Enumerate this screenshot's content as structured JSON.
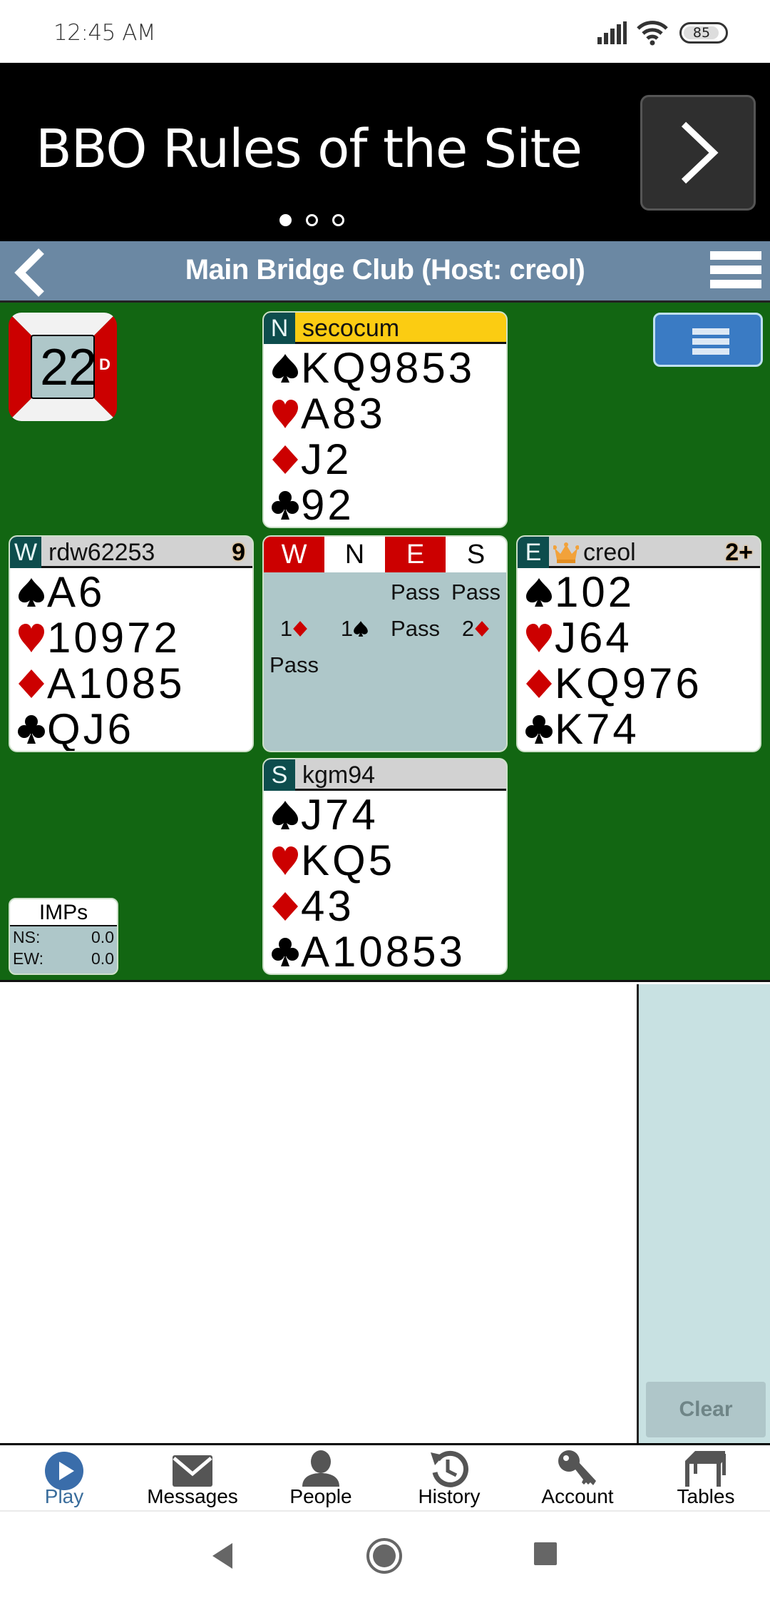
{
  "status_bar": {
    "time": "12:45 AM",
    "battery": "85"
  },
  "banner": {
    "title": "BBO Rules of the Site",
    "page_count": 3,
    "active_page": 1
  },
  "header": {
    "title": "Main Bridge Club (Host: creol)"
  },
  "board": {
    "number": "22",
    "dealer": "D"
  },
  "colors": {
    "felt": "#126612",
    "vulnerable": "#cc0000",
    "seat_bg": "#0d4d4d",
    "active_player": "#fbcc12",
    "accent": "#3a6d9c"
  },
  "hands": {
    "north": {
      "seat": "N",
      "player": "secocum",
      "active": true,
      "badge": "",
      "spades": "KQ9853",
      "hearts": "A83",
      "diamonds": "J2",
      "clubs": "92"
    },
    "west": {
      "seat": "W",
      "player": "rdw62253",
      "badge": "9",
      "spades": "A6",
      "hearts": "10972",
      "diamonds": "A1085",
      "clubs": "QJ6"
    },
    "east": {
      "seat": "E",
      "player": "creol",
      "host_crown": true,
      "badge": "2+",
      "spades": "102",
      "hearts": "J64",
      "diamonds": "KQ976",
      "clubs": "K74"
    },
    "south": {
      "seat": "S",
      "player": "kgm94",
      "badge": "",
      "spades": "J74",
      "hearts": "KQ5",
      "diamonds": "43",
      "clubs": "A10853"
    }
  },
  "auction": {
    "headers": [
      {
        "label": "W",
        "vulnerable": true
      },
      {
        "label": "N",
        "vulnerable": false
      },
      {
        "label": "E",
        "vulnerable": true
      },
      {
        "label": "S",
        "vulnerable": false
      }
    ],
    "calls": [
      {
        "text": "",
        "suit": ""
      },
      {
        "text": "",
        "suit": ""
      },
      {
        "text": "Pass",
        "suit": ""
      },
      {
        "text": "Pass",
        "suit": ""
      },
      {
        "text": "1",
        "suit": "diamonds"
      },
      {
        "text": "1",
        "suit": "spades"
      },
      {
        "text": "Pass",
        "suit": ""
      },
      {
        "text": "2",
        "suit": "diamonds"
      },
      {
        "text": "Pass",
        "suit": ""
      }
    ]
  },
  "scores": {
    "title": "IMPs",
    "ns_label": "NS:",
    "ns_value": "0.0",
    "ew_label": "EW:",
    "ew_value": "0.0"
  },
  "side_panel": {
    "clear_label": "Clear"
  },
  "bottom_nav": {
    "items": [
      {
        "label": "Play",
        "icon": "play-icon",
        "active": true
      },
      {
        "label": "Messages",
        "icon": "envelope-icon",
        "active": false
      },
      {
        "label": "People",
        "icon": "person-icon",
        "active": false
      },
      {
        "label": "History",
        "icon": "history-icon",
        "active": false
      },
      {
        "label": "Account",
        "icon": "key-icon",
        "active": false
      },
      {
        "label": "Tables",
        "icon": "table-icon",
        "active": false
      }
    ]
  }
}
